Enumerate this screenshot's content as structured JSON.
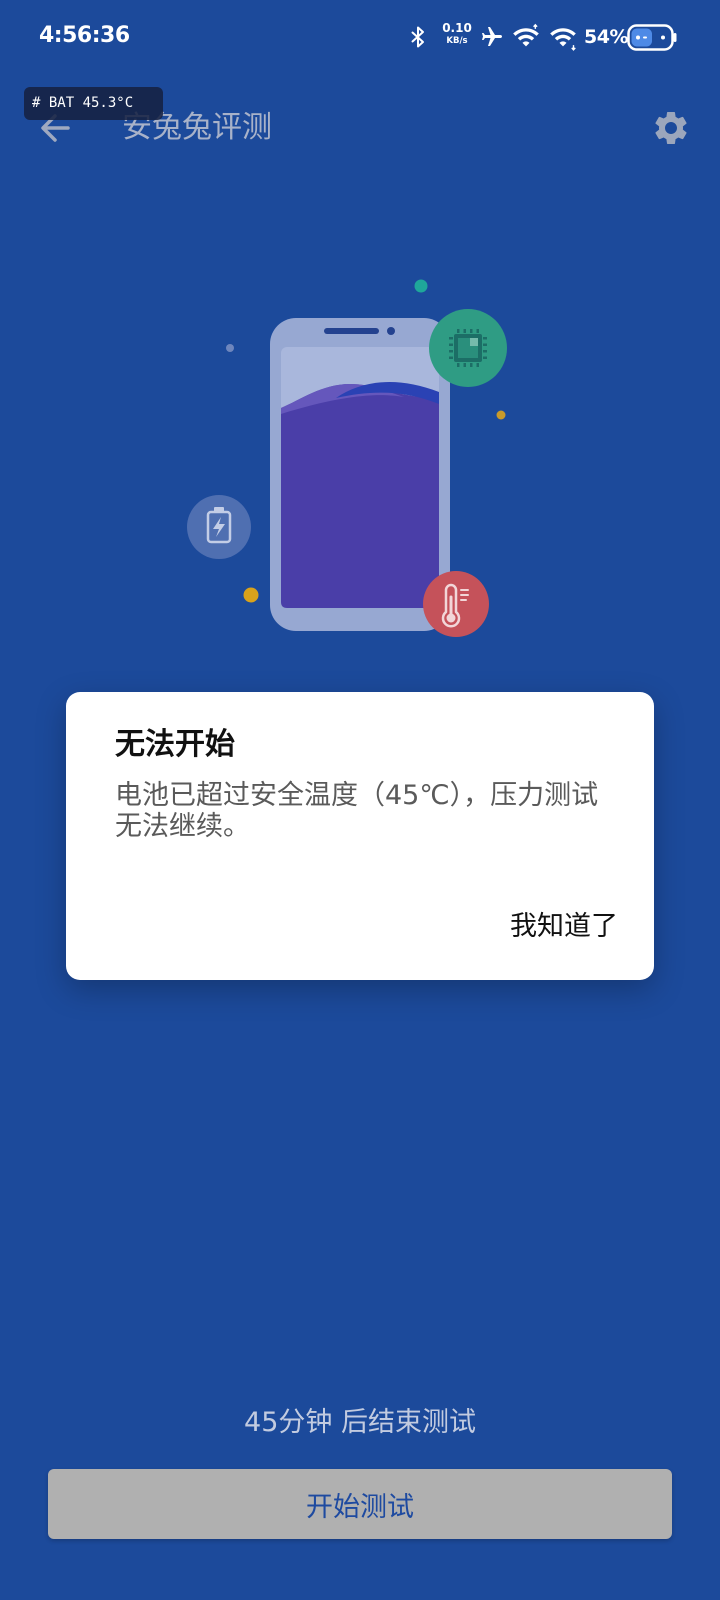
{
  "status_bar": {
    "time": "4:56:36",
    "net_speed": {
      "value": "0.10",
      "unit": "KB/s"
    },
    "battery_percent": "54%",
    "icons": {
      "bluetooth": "bluetooth-icon",
      "airplane": "airplane-mode-icon",
      "wifi_1": "wifi-icon",
      "wifi_2": "wifi-icon",
      "battery": "battery-icon"
    }
  },
  "debug_overlay": {
    "text": "# BAT 45.3°C"
  },
  "header": {
    "title": "安兔兔评测",
    "back_icon": "arrow-left-icon",
    "settings_icon": "gear-icon"
  },
  "illustration": {
    "icons": [
      "phone-illustration",
      "chip-icon",
      "thermometer-icon",
      "battery-charging-icon"
    ]
  },
  "dialog": {
    "title": "无法开始",
    "message": "电池已超过安全温度（45℃），压力测试无法继续。",
    "confirm_label": "我知道了"
  },
  "footer": {
    "countdown_text": "45分钟 后结束测试",
    "start_button_label": "开始测试"
  },
  "colors": {
    "background": "#1c4a9b",
    "dialog_background": "#ffffff",
    "start_button_background": "#b0b0b0",
    "start_button_text": "#1e4aa0",
    "chip_badge": "#2f9c84",
    "thermometer_badge": "#c5525a",
    "battery_badge": "#5876b5",
    "screen_fill": "#4a3ea8"
  }
}
